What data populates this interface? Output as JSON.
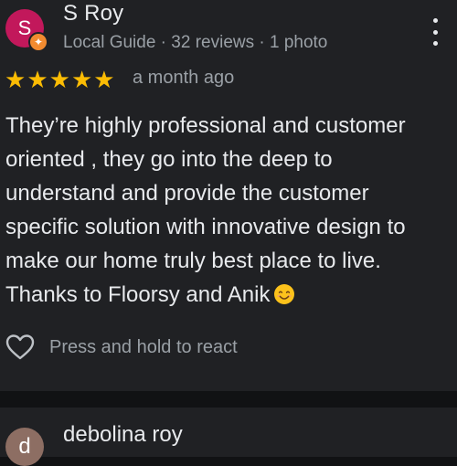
{
  "review": {
    "avatar_initial": "S",
    "guide_badge": "✦",
    "reviewer_name": "S Roy",
    "reviewer_meta": "Local Guide · 32 reviews · 1 photo",
    "rating": 5,
    "stars": [
      "★",
      "★",
      "★",
      "★",
      "★"
    ],
    "time_ago": "a month ago",
    "text_lines": [
      "They’re highly professional and customer",
      "oriented , they go into the deep to",
      "understand and provide the customer",
      "specific solution with innovative design to",
      "make our home truly best place to live.",
      "Thanks to Floorsy and Anik"
    ],
    "react_label": "Press and hold to react"
  },
  "next_review": {
    "avatar_initial": "d",
    "reviewer_name": "debolina roy"
  },
  "colors": {
    "background": "#111214",
    "card": "#202124",
    "avatar_s": "#c2185b",
    "avatar_d": "#8d6e63",
    "star": "#fbbc04",
    "badge": "#f28b30"
  },
  "icons": {
    "menu": "kebab-menu-icon",
    "react": "heart-outline-icon",
    "emoji": "smiling-face-emoji-icon",
    "badge": "local-guide-badge-icon"
  }
}
